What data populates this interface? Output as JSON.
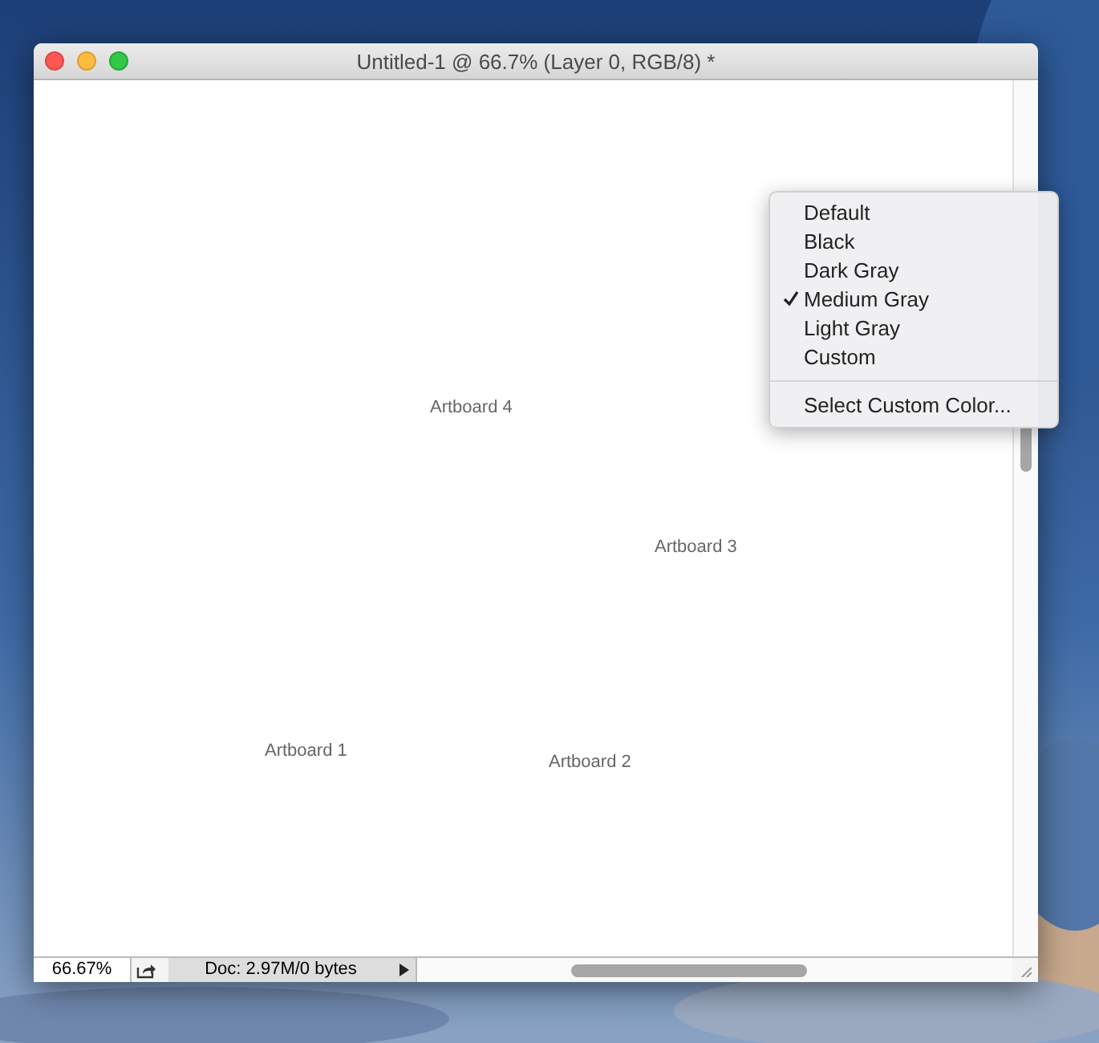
{
  "window": {
    "title": "Untitled-1 @ 66.7% (Layer 0, RGB/8) *"
  },
  "canvas": {
    "artboards": [
      "Artboard 4",
      "Artboard 3",
      "Artboard 1",
      "Artboard 2"
    ]
  },
  "context_menu": {
    "items": [
      {
        "label": "Default",
        "checked": false
      },
      {
        "label": "Black",
        "checked": false
      },
      {
        "label": "Dark Gray",
        "checked": false
      },
      {
        "label": "Medium Gray",
        "checked": true
      },
      {
        "label": "Light Gray",
        "checked": false
      },
      {
        "label": "Custom",
        "checked": false
      }
    ],
    "actions": [
      "Select Custom Color..."
    ]
  },
  "status_bar": {
    "zoom": "66.67%",
    "doc_info": "Doc: 2.97M/0 bytes"
  }
}
